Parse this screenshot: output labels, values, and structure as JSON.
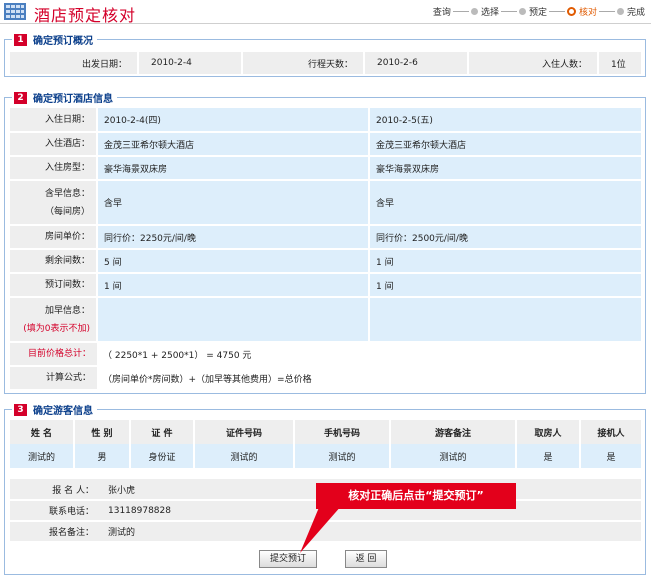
{
  "header": {
    "title": "酒店预定核对",
    "steps": [
      {
        "label": "查询",
        "current": false
      },
      {
        "label": "选择",
        "current": false
      },
      {
        "label": "预定",
        "current": false
      },
      {
        "label": "核对",
        "current": true
      },
      {
        "label": "完成",
        "current": false
      }
    ]
  },
  "section1": {
    "num": "1",
    "title": "确定预订概况",
    "depart_label": "出发日期：",
    "depart_value": "2010-2-4",
    "days_label": "行程天数：",
    "days_value": "2010-2-6",
    "guests_label": "入住人数：",
    "guests_value": "1位"
  },
  "section2": {
    "num": "2",
    "title": "确定预订酒店信息",
    "rows": [
      {
        "label": "入住日期：",
        "v1": "2010-2-4(四)",
        "v2": "2010-2-5(五)"
      },
      {
        "label": "入住酒店：",
        "v1": "金茂三亚希尔顿大酒店",
        "v2": "金茂三亚希尔顿大酒店"
      },
      {
        "label": "入住房型：",
        "v1": "豪华海景双床房",
        "v2": "豪华海景双床房"
      },
      {
        "label": "含早信息：",
        "label2": "（每间房）",
        "v1": "含早",
        "v2": "含早"
      },
      {
        "label": "房间单价：",
        "v1": "同行价：2250元/间/晚",
        "v2": "同行价：2500元/间/晚"
      },
      {
        "label": "剩余间数：",
        "v1": "5 间",
        "v2": "1 间"
      },
      {
        "label": "预订间数：",
        "v1": "1 间",
        "v2": "1 间"
      },
      {
        "label": "加早信息：",
        "label2": "(填为0表示不加)",
        "v1": "",
        "v2": ""
      }
    ],
    "total_label": "目前价格总计：",
    "total_value": "（ 2250*1 + 2500*1） = 4750 元",
    "formula_label": "计算公式：",
    "formula_value": "（房间单价*房间数）+（加早等其他费用）=总价格"
  },
  "section3": {
    "num": "3",
    "title": "确定游客信息",
    "columns": [
      "姓 名",
      "性 别",
      "证 件",
      "证件号码",
      "手机号码",
      "游客备注",
      "取房人",
      "接机人"
    ],
    "guest": [
      "测试的",
      "男",
      "身份证",
      "测试的",
      "测试的",
      "测试的",
      "是",
      "是"
    ],
    "applicant_label": "报 名 人：",
    "applicant_value": "张小虎",
    "phone_label": "联系电话：",
    "phone_value": "13118978828",
    "note_label": "报名备注：",
    "note_value": "测试的",
    "submit_label": "提交预订",
    "back_label": "返 回"
  },
  "callout": {
    "text": "核对正确后点击“提交预订”"
  },
  "colors": {
    "accent_red": "#d4002a",
    "title_blue": "#0b3f8b",
    "row_blue": "#ddeefb",
    "step_orange": "#e05a00"
  }
}
